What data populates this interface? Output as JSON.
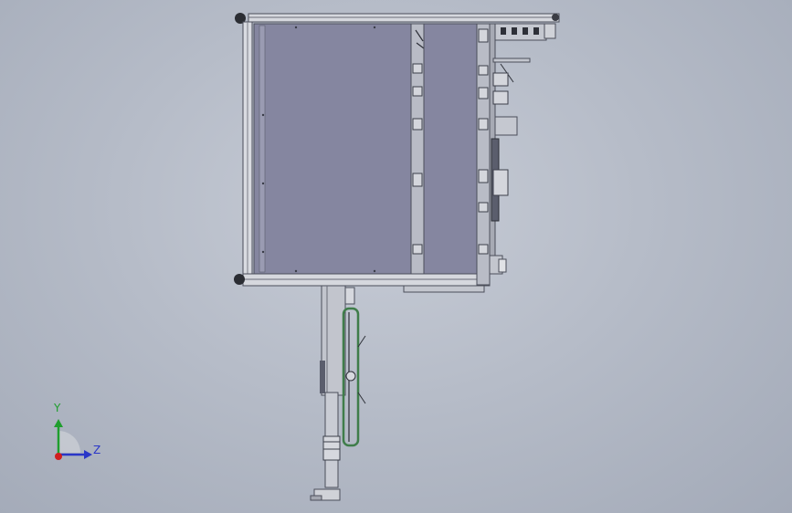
{
  "viewport": {
    "background_top": "#c7ccd6",
    "background_bottom": "#a3aab8"
  },
  "model": {
    "panel_color": "#8586a0",
    "frame_color": "#5b5e6d",
    "steel_color": "#c9ccd4",
    "accent_green": "#3f7d4a"
  },
  "triad": {
    "y_label": "Y",
    "z_label": "Z",
    "y_color": "#1f9e2e",
    "z_color": "#2a36c8",
    "x_color": "#d11f1f"
  }
}
